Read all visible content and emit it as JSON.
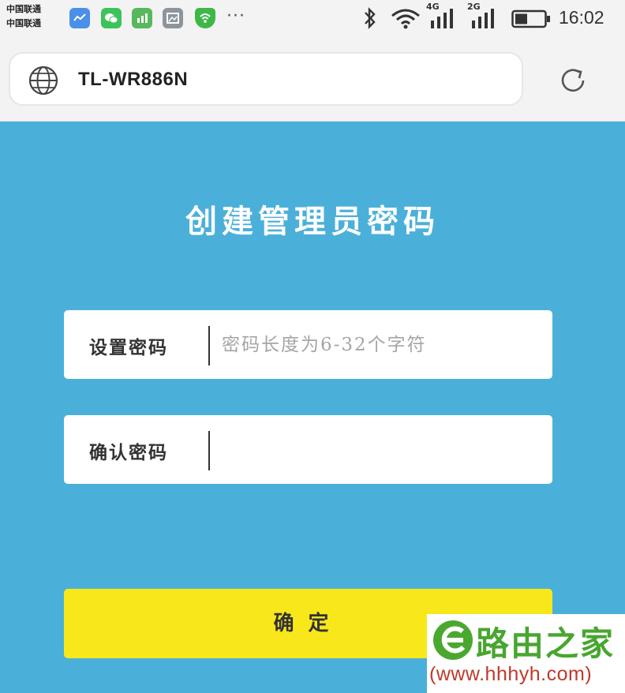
{
  "status_bar": {
    "carrier_line_1": "中国联通",
    "carrier_line_2": "中国联通",
    "more": "···",
    "network_4g": "4G",
    "network_2g": "2G",
    "time": "16:02"
  },
  "browser": {
    "url": "TL-WR886N"
  },
  "page": {
    "title": "创建管理员密码",
    "password_label": "设置密码",
    "password_placeholder": "密码长度为6-32个字符",
    "confirm_label": "确认密码",
    "confirm_value": "",
    "submit_label": "确定"
  },
  "watermark": {
    "name": "路由之家",
    "url": "(www.hhhyh.com)"
  },
  "colors": {
    "page_background": "#4bb0d9",
    "button_yellow": "#f8e81b",
    "watermark_green": "#48a62f",
    "watermark_red": "#c0392b"
  },
  "icons": [
    "weather-icon",
    "wechat-icon",
    "app-icon",
    "gallery-icon",
    "shield-wifi-icon",
    "bluetooth-icon",
    "wifi-icon",
    "signal-icon",
    "battery-icon",
    "globe-icon",
    "refresh-icon"
  ]
}
